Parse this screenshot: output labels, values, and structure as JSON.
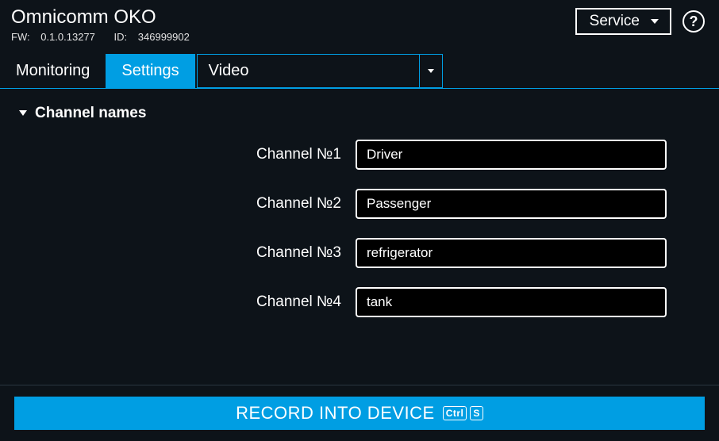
{
  "header": {
    "title": "Omnicomm OKO",
    "fw_label": "FW:",
    "fw_value": "0.1.0.13277",
    "id_label": "ID:",
    "id_value": "346999902",
    "service_label": "Service",
    "help_label": "?"
  },
  "tabs": {
    "monitoring": "Monitoring",
    "settings": "Settings"
  },
  "dropdown": {
    "selected": "Video"
  },
  "section": {
    "title": "Channel names",
    "channels": [
      {
        "label": "Channel №1",
        "value": "Driver"
      },
      {
        "label": "Channel №2",
        "value": "Passenger"
      },
      {
        "label": "Channel №3",
        "value": "refrigerator"
      },
      {
        "label": "Channel №4",
        "value": "tank"
      }
    ]
  },
  "footer": {
    "record_label": "RECORD INTO DEVICE",
    "shortcut_ctrl": "Ctrl",
    "shortcut_key": "S"
  }
}
